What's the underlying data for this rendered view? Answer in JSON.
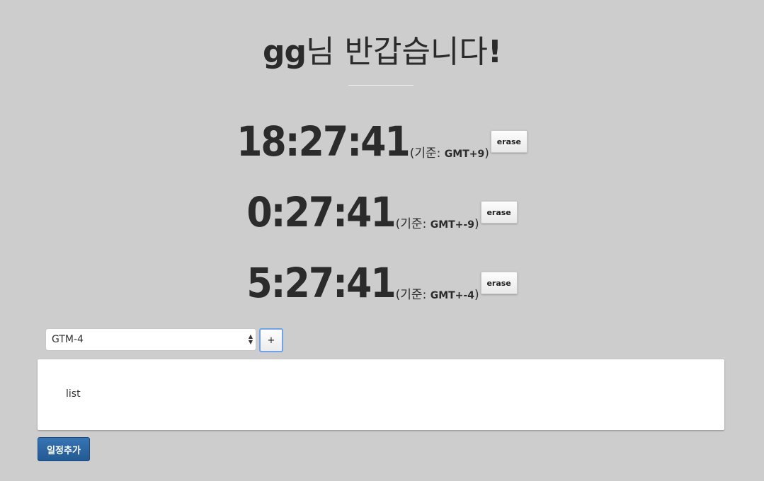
{
  "header": {
    "name": "gg",
    "greeting_suffix": "님 반갑습니다",
    "exclamation": "!"
  },
  "clocks": [
    {
      "time": "18:27:41",
      "basis_prefix": "(기준: ",
      "gmt": "GMT+9",
      "basis_suffix": ")",
      "erase_label": "erase"
    },
    {
      "time": "0:27:41",
      "basis_prefix": "(기준: ",
      "gmt": "GMT+-9",
      "basis_suffix": ")",
      "erase_label": "erase"
    },
    {
      "time": "5:27:41",
      "basis_prefix": "(기준: ",
      "gmt": "GMT+-4",
      "basis_suffix": ")",
      "erase_label": "erase"
    }
  ],
  "controls": {
    "timezone_selected": "GTM-4",
    "add_label": "+"
  },
  "list": {
    "label": "list"
  },
  "schedule_button": "일정추가",
  "colors": {
    "background": "#cdcdcd",
    "primary_button": "#235a94",
    "focus_ring": "#6fa2e8"
  }
}
